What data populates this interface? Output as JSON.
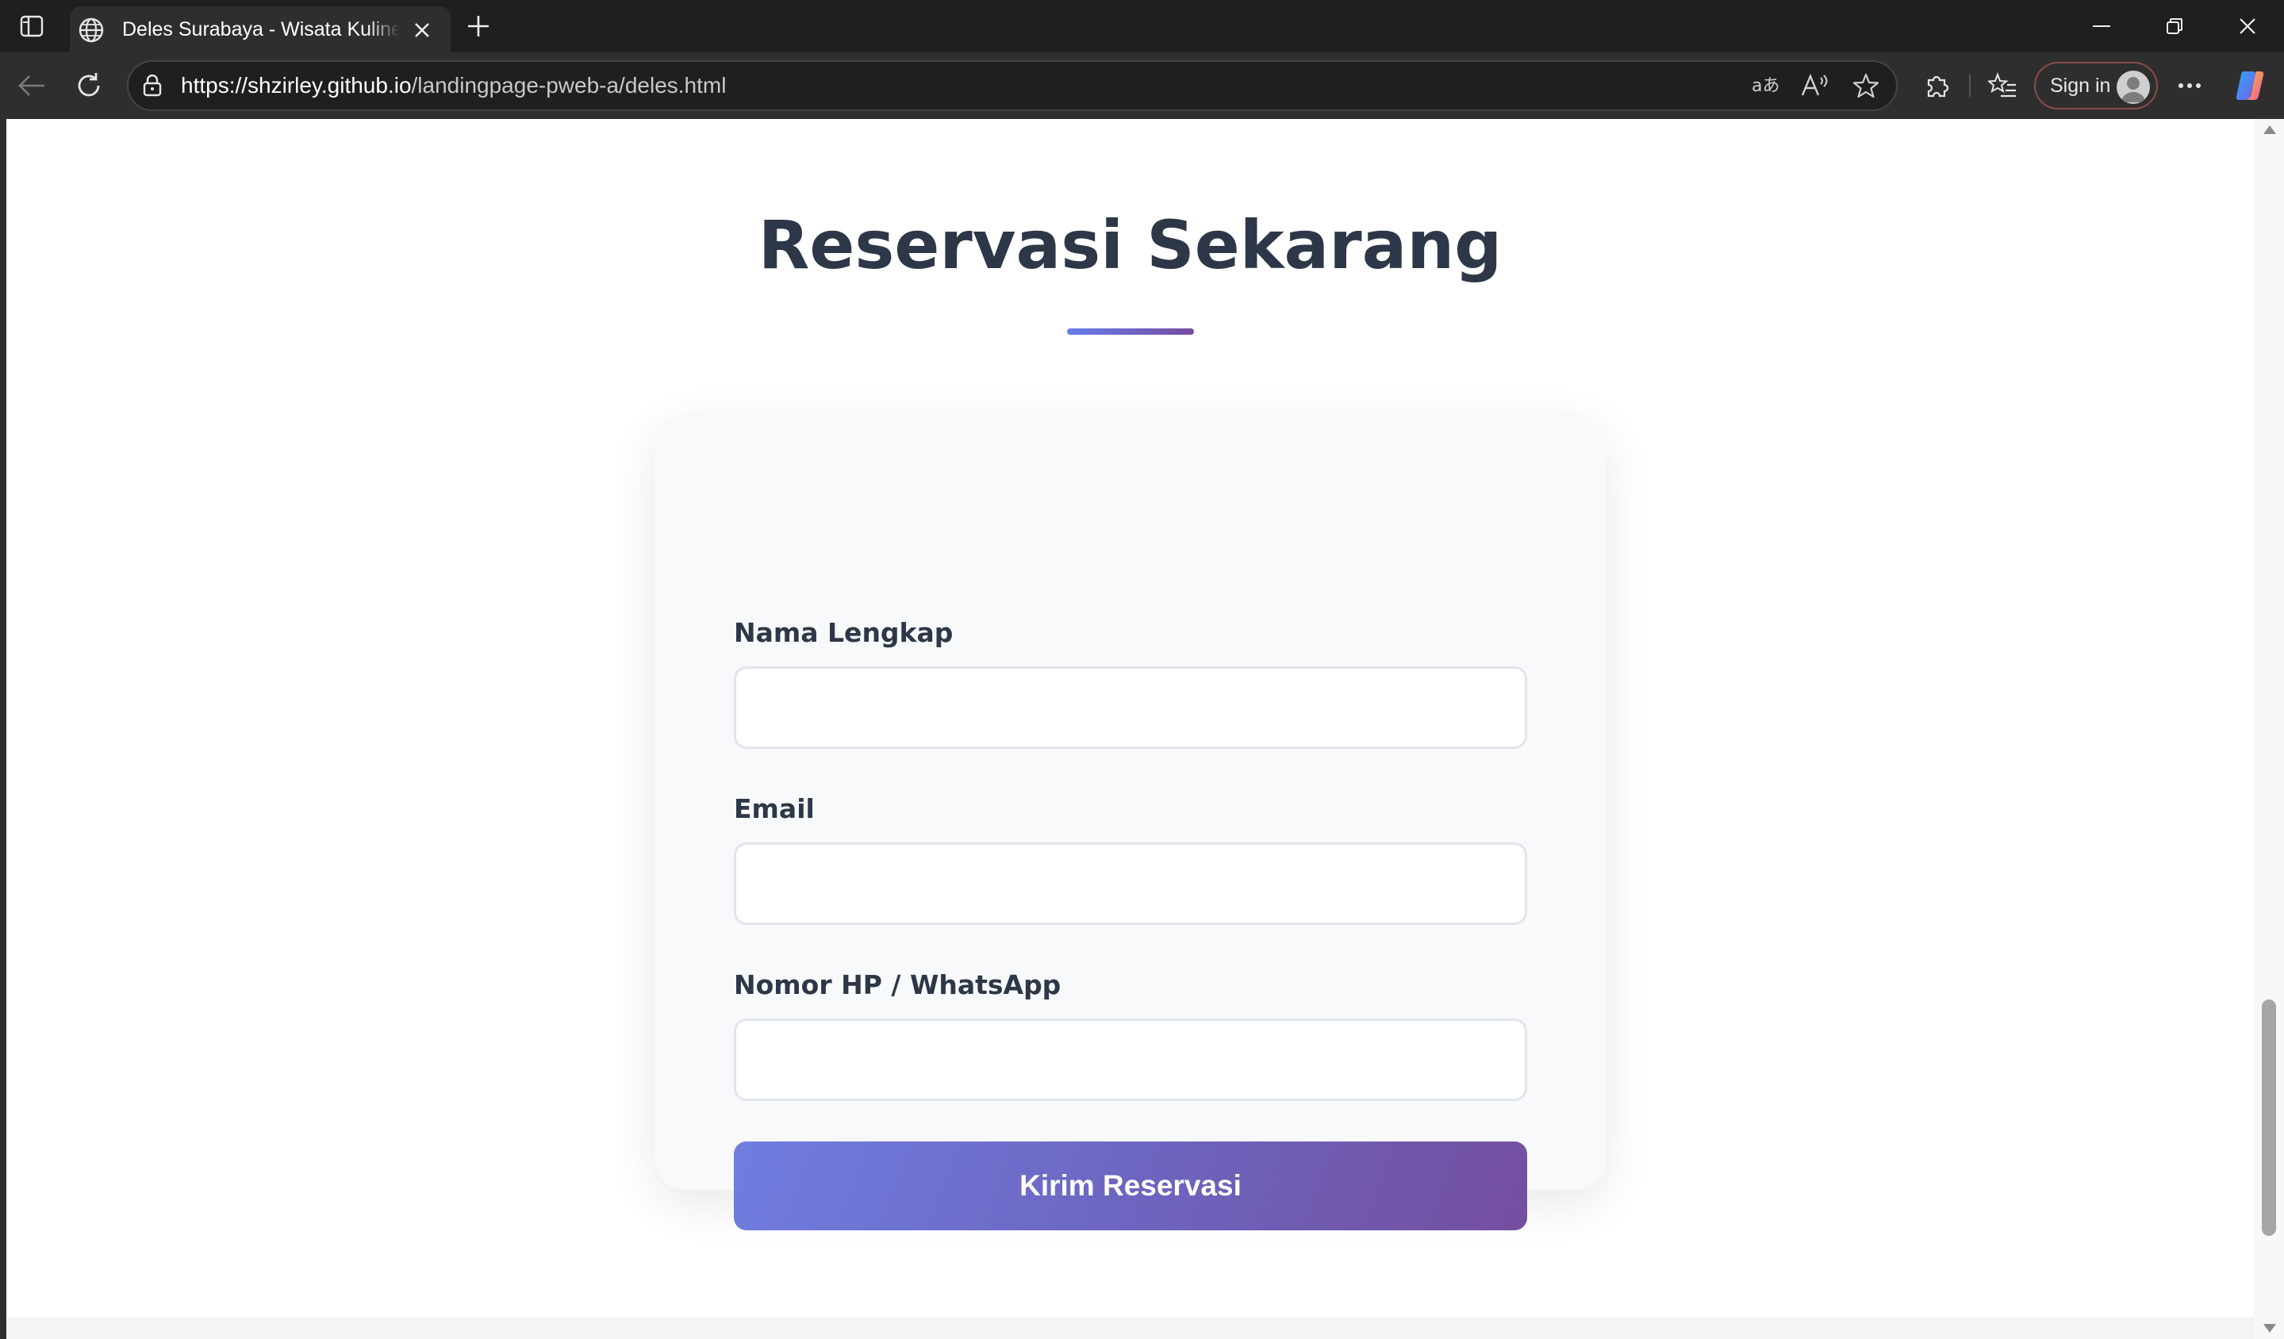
{
  "browser": {
    "tab_title": "Deles Surabaya - Wisata Kuliner Legendaris",
    "url_host": "https://shzirley.github.io",
    "url_path": "/landingpage-pweb-a/deles.html",
    "sign_in_label": "Sign in"
  },
  "icons": {
    "tab_actions": "tab-actions-icon",
    "favicon": "globe-icon",
    "close_tab": "close-icon",
    "new_tab": "plus-icon",
    "back": "back-arrow-icon",
    "refresh": "refresh-icon",
    "site_info": "lock-icon",
    "translate": "translate-icon",
    "read_aloud": "read-aloud-icon",
    "favorite": "star-icon",
    "extensions": "puzzle-icon",
    "favorites": "favorites-list-icon",
    "more": "more-icon",
    "copilot": "copilot-icon"
  },
  "page": {
    "section_title": "Reservasi Sekarang",
    "form": {
      "name_label": "Nama Lengkap",
      "name_value": "",
      "email_label": "Email",
      "email_value": "",
      "phone_label": "Nomor HP / WhatsApp",
      "phone_value": "",
      "submit_label": "Kirim Reservasi"
    }
  },
  "colors": {
    "heading": "#2d3748",
    "accent_start": "#667eea",
    "accent_end": "#764ba2",
    "card_bg": "#f7f9fa"
  }
}
